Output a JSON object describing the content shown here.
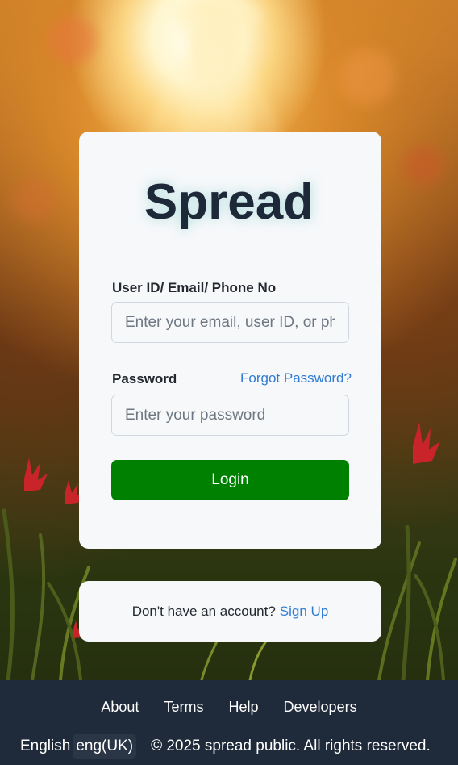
{
  "app": {
    "name": "Spread"
  },
  "login": {
    "user_label": "User ID/ Email/ Phone No",
    "user_placeholder": "Enter your email, user ID, or phone number",
    "password_label": "Password",
    "forgot_link": "Forgot Password?",
    "password_placeholder": "Enter your password",
    "login_button": "Login"
  },
  "signup": {
    "prompt": "Don't have an account?",
    "link": "Sign Up"
  },
  "footer": {
    "links": [
      "About",
      "Terms",
      "Help",
      "Developers"
    ],
    "language_label": "English",
    "language_value": "eng(UK)",
    "copyright": "© 2025 spread public. All rights reserved."
  },
  "colors": {
    "primary_button": "#008000",
    "link": "#2f7bd3",
    "footer_bg": "#1f2a3a",
    "card_bg": "#f6f8fa"
  }
}
